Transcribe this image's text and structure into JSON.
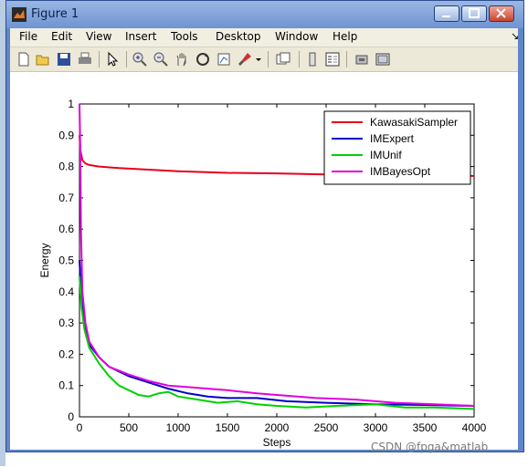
{
  "window": {
    "title": "Figure 1"
  },
  "menu": [
    "File",
    "Edit",
    "View",
    "Insert",
    "Tools",
    "Desktop",
    "Window",
    "Help"
  ],
  "toolbar_icons": [
    "new-figure-icon",
    "open-icon",
    "save-icon",
    "print-icon",
    "select-arrow-icon",
    "zoom-in-icon",
    "zoom-out-icon",
    "pan-icon",
    "rotate-icon",
    "data-cursor-icon",
    "brush-icon",
    "link-icon",
    "colorbar-icon",
    "legend-icon",
    "hide-plot-tools-icon",
    "show-plot-tools-icon"
  ],
  "watermark": "CSDN @fpga&matlab",
  "colors": {
    "KawasakiSampler": "#e8001c",
    "IMExpert": "#0000c8",
    "IMUnif": "#00d000",
    "IMBayesOpt": "#e000e0"
  },
  "chart_data": {
    "type": "line",
    "xlabel": "Steps",
    "ylabel": "Energy",
    "xlim": [
      0,
      4000
    ],
    "ylim": [
      0,
      1
    ],
    "xticks": [
      0,
      500,
      1000,
      1500,
      2000,
      2500,
      3000,
      3500,
      4000
    ],
    "yticks": [
      0,
      0.1,
      0.2,
      0.3,
      0.4,
      0.5,
      0.6,
      0.7,
      0.8,
      0.9,
      1
    ],
    "ytick_labels": [
      "0",
      "0.1",
      "0.2",
      "0.3",
      "0.4",
      "0.5",
      "0.6",
      "0.7",
      "0.8",
      "0.9",
      "1"
    ],
    "grid": false,
    "legend_position": "top-right",
    "series": [
      {
        "name": "KawasakiSampler",
        "color": "#e8001c",
        "x": [
          0,
          10,
          30,
          60,
          100,
          200,
          400,
          700,
          1000,
          1500,
          2000,
          2500,
          3000,
          3500,
          4000
        ],
        "y": [
          0.9,
          0.85,
          0.82,
          0.81,
          0.805,
          0.8,
          0.795,
          0.79,
          0.785,
          0.78,
          0.778,
          0.775,
          0.773,
          0.771,
          0.77
        ]
      },
      {
        "name": "IMExpert",
        "color": "#0000c8",
        "x": [
          0,
          20,
          50,
          100,
          200,
          300,
          500,
          700,
          900,
          1100,
          1300,
          1500,
          1800,
          2100,
          2500,
          3000,
          3500,
          4000
        ],
        "y": [
          0.5,
          0.38,
          0.3,
          0.23,
          0.19,
          0.16,
          0.13,
          0.11,
          0.09,
          0.075,
          0.065,
          0.06,
          0.06,
          0.05,
          0.045,
          0.04,
          0.038,
          0.035
        ]
      },
      {
        "name": "IMUnif",
        "color": "#00d000",
        "x": [
          0,
          20,
          50,
          100,
          200,
          300,
          400,
          500,
          600,
          700,
          800,
          900,
          1000,
          1200,
          1400,
          1600,
          1800,
          2000,
          2300,
          2600,
          3000,
          3300,
          3600,
          4000
        ],
        "y": [
          0.45,
          0.35,
          0.28,
          0.22,
          0.17,
          0.13,
          0.1,
          0.085,
          0.07,
          0.065,
          0.075,
          0.08,
          0.065,
          0.055,
          0.045,
          0.05,
          0.04,
          0.035,
          0.03,
          0.035,
          0.04,
          0.03,
          0.03,
          0.025
        ]
      },
      {
        "name": "IMBayesOpt",
        "color": "#e000e0",
        "x": [
          0,
          8,
          15,
          30,
          60,
          100,
          200,
          300,
          500,
          700,
          900,
          1100,
          1300,
          1500,
          1800,
          2000,
          2400,
          2800,
          3200,
          3600,
          4000
        ],
        "y": [
          1.0,
          0.85,
          0.6,
          0.4,
          0.3,
          0.24,
          0.19,
          0.16,
          0.135,
          0.115,
          0.1,
          0.095,
          0.09,
          0.085,
          0.075,
          0.07,
          0.06,
          0.055,
          0.045,
          0.04,
          0.035
        ]
      }
    ]
  }
}
